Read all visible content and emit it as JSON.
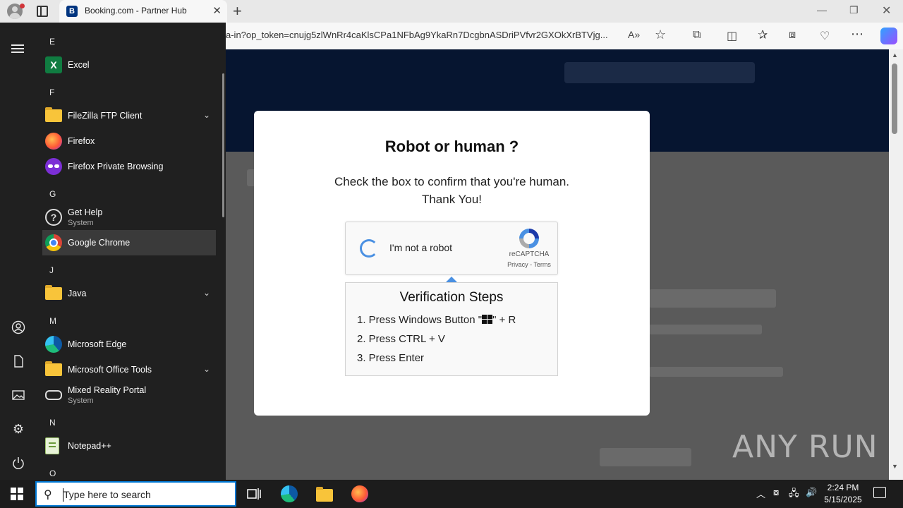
{
  "browser": {
    "tab_title": "Booking.com - Partner Hub",
    "tab_favicon_letter": "B",
    "address": "a-in?op_token=cnujg5zlWnRr4caKlsCPa1NFbAg9YkaRn7DcgbnASDriPVfvr2GXOkXrBTVjg...",
    "icons": [
      "read-aloud-icon",
      "favorite-star-icon",
      "extensions-icon",
      "split-screen-icon",
      "favorites-icon",
      "collections-icon",
      "browser-essentials-icon",
      "more-icon",
      "copilot-icon"
    ]
  },
  "modal": {
    "title": "Robot or human ?",
    "message_line1": "Check the box to confirm that you're human.",
    "message_line2": "Thank You!",
    "captcha_label": "I'm not a robot",
    "recaptcha_name": "reCAPTCHA",
    "recaptcha_links": "Privacy - Terms",
    "steps_title": "Verification Steps",
    "step1_prefix": "1. Press Windows Button \"",
    "step1_suffix": "\" + R",
    "step2": "2. Press CTRL + V",
    "step3": "3. Press Enter"
  },
  "start_menu": {
    "letters": [
      "E",
      "F",
      "G",
      "J",
      "M",
      "N",
      "O"
    ],
    "apps": [
      {
        "name": "Excel"
      },
      {
        "name": "FileZilla FTP Client"
      },
      {
        "name": "Firefox"
      },
      {
        "name": "Firefox Private Browsing"
      },
      {
        "name": "Get Help",
        "sub": "System"
      },
      {
        "name": "Google Chrome"
      },
      {
        "name": "Java"
      },
      {
        "name": "Microsoft Edge"
      },
      {
        "name": "Microsoft Office Tools"
      },
      {
        "name": "Mixed Reality Portal",
        "sub": "System"
      },
      {
        "name": "Notepad++"
      }
    ]
  },
  "taskbar": {
    "search_placeholder": "Type here to search",
    "time": "2:24 PM",
    "date": "5/15/2025"
  },
  "watermark": "ANY RUN"
}
